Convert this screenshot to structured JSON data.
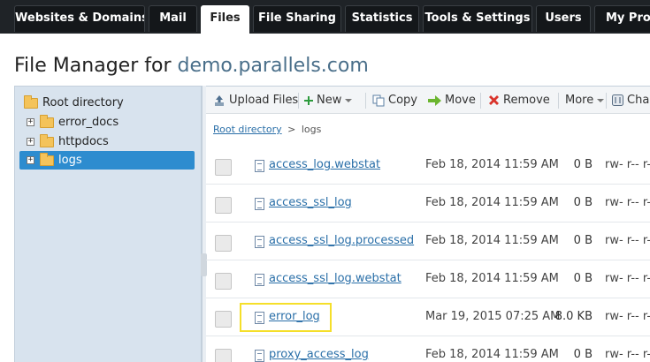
{
  "tabs": [
    {
      "label": "Websites & Domains",
      "active": false
    },
    {
      "label": "Mail",
      "active": false
    },
    {
      "label": "Files",
      "active": true
    },
    {
      "label": "File Sharing",
      "active": false
    },
    {
      "label": "Statistics",
      "active": false
    },
    {
      "label": "Tools & Settings",
      "active": false
    },
    {
      "label": "Users",
      "active": false
    },
    {
      "label": "My Profi",
      "active": false
    }
  ],
  "page_title": {
    "prefix": "File Manager for ",
    "domain": "demo.parallels.com"
  },
  "tree": {
    "root": "Root directory",
    "items": [
      {
        "label": "error_docs",
        "expander": "+",
        "selected": false
      },
      {
        "label": "httpdocs",
        "expander": "+",
        "selected": false
      },
      {
        "label": "logs",
        "expander": "+",
        "selected": true
      }
    ]
  },
  "toolbar": {
    "upload": "Upload Files",
    "new": "New",
    "copy": "Copy",
    "move": "Move",
    "remove": "Remove",
    "more": "More",
    "change": "Cha"
  },
  "breadcrumb": {
    "root": "Root directory",
    "separator": ">",
    "current": "logs"
  },
  "files": [
    {
      "name": "access_log.webstat",
      "date": "Feb 18, 2014 11:59 AM",
      "size": "0 B",
      "perms": "rw- r-- r--"
    },
    {
      "name": "access_ssl_log",
      "date": "Feb 18, 2014 11:59 AM",
      "size": "0 B",
      "perms": "rw- r-- r--"
    },
    {
      "name": "access_ssl_log.processed",
      "date": "Feb 18, 2014 11:59 AM",
      "size": "0 B",
      "perms": "rw- r-- r--"
    },
    {
      "name": "access_ssl_log.webstat",
      "date": "Feb 18, 2014 11:59 AM",
      "size": "0 B",
      "perms": "rw- r-- r--"
    },
    {
      "name": "error_log",
      "date": "Mar 19, 2015 07:25 AM",
      "size": "8.0 KB",
      "perms": "rw- r-- r--"
    },
    {
      "name": "proxy_access_log",
      "date": "Feb 18, 2014 11:59 AM",
      "size": "0 B",
      "perms": "rw- r-- r--"
    }
  ],
  "colors": {
    "accent": "#2d8ccf",
    "highlight": "#f5df2a",
    "link": "#2a6fa8"
  }
}
